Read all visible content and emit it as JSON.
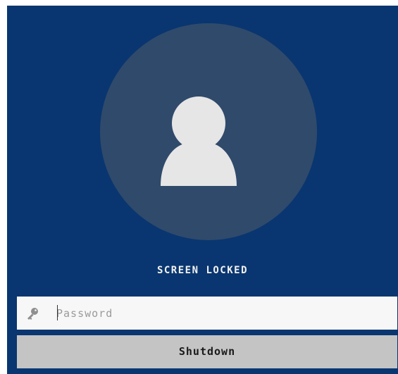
{
  "lock_screen": {
    "title": "SCREEN LOCKED",
    "avatar_icon": "user-silhouette-icon",
    "password": {
      "value": "",
      "placeholder": "Password",
      "icon": "key-icon"
    },
    "shutdown_label": "Shutdown"
  },
  "colors": {
    "background": "#093670",
    "avatar_circle": "#304a6b",
    "avatar_figure": "#e6e6e6",
    "input_background": "#f7f7f7",
    "button_background": "#c4c4c4",
    "title_text": "#f2f2f2"
  }
}
